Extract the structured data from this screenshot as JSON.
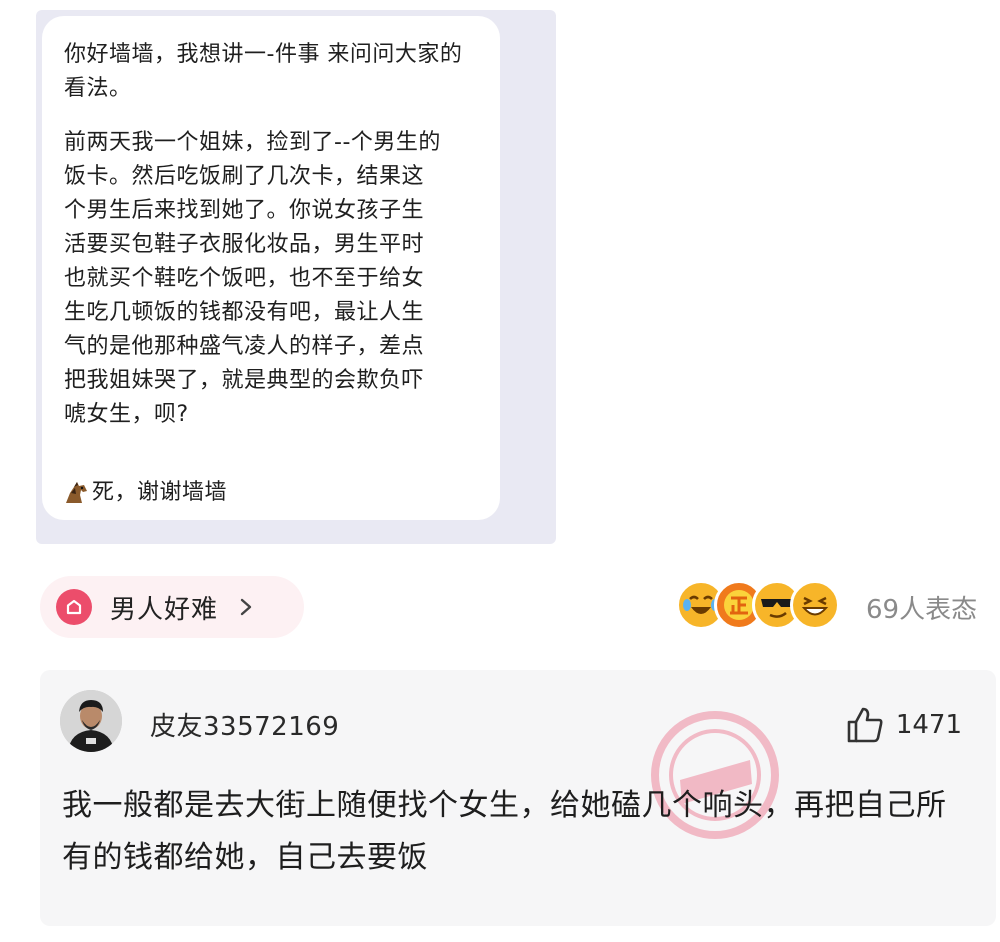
{
  "post": {
    "greeting": "你好墙墙，我想讲一-件事 来问问大家的看法。",
    "body": "前两天我一个姐妹，捡到了-‐个男生的饭卡。然后吃饭刷了几次卡，结果这个男生后来找到她了。你说女孩子生活要买包鞋子衣服化妆品，男生平时也就买个鞋吃个饭吧，也不至于给女生吃几顿饭的钱都没有吧，最让人生气的是他那种盛气凌人的样子，差点把我姐妹哭了，就是典型的会欺负吓唬女生，呗?",
    "sign_off": "死，谢谢墙墙",
    "sign_icon": "horse-emoji-icon"
  },
  "topic": {
    "label": "男人好难",
    "icon": "topic-home-icon",
    "chevron": "chevron-right-icon"
  },
  "reactions": {
    "icons": [
      "laugh-cry-emoji-icon",
      "zheng-badge-emoji-icon",
      "sunglasses-emoji-icon",
      "grin-emoji-icon"
    ],
    "count_label": "69人表态"
  },
  "comment": {
    "username": "皮友33572169",
    "likes": "1471",
    "text": "我一般都是去大街上随便找个女生，给她磕几个响头，再把自己所有的钱都给她，自己去要饭"
  },
  "colors": {
    "topic_accent": "#ec4d6b",
    "topic_bg": "#fdf1f3",
    "card_bg": "#f6f6f7",
    "screenshot_bg": "#e9e9f3"
  }
}
